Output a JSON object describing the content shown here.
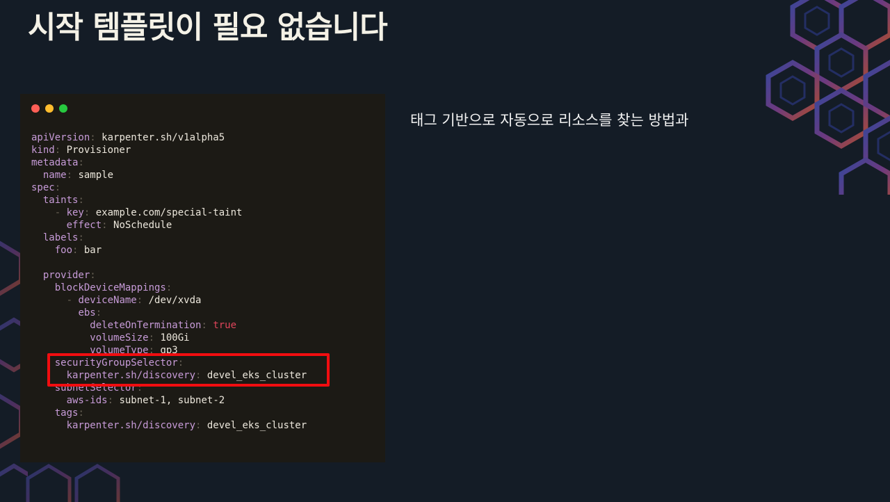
{
  "slide": {
    "title": "시작 템플릿이 필요 없습니다",
    "caption": "태그 기반으로 자동으로 리소스를 찾는 방법과"
  },
  "colors": {
    "background": "#141c26",
    "code_background": "#1c1a15",
    "yaml_key": "#c79bd8",
    "yaml_value": "#ece7dc",
    "yaml_boolean": "#e0455b",
    "highlight_border": "#f10d10",
    "traffic_red": "#ff5f56",
    "traffic_yellow": "#ffbd2e",
    "traffic_green": "#27c93f"
  },
  "code_window": {
    "traffic_lights": [
      "close-dot",
      "minimize-dot",
      "maximize-dot"
    ],
    "lines": [
      {
        "indent": "",
        "dash": "",
        "key": "apiVersion",
        "value": "karpenter.sh/v1alpha5",
        "value_type": "str"
      },
      {
        "indent": "",
        "dash": "",
        "key": "kind",
        "value": "Provisioner",
        "value_type": "str"
      },
      {
        "indent": "",
        "dash": "",
        "key": "metadata",
        "value": "",
        "value_type": "str"
      },
      {
        "indent": "  ",
        "dash": "",
        "key": "name",
        "value": "sample",
        "value_type": "str"
      },
      {
        "indent": "",
        "dash": "",
        "key": "spec",
        "value": "",
        "value_type": "str"
      },
      {
        "indent": "  ",
        "dash": "",
        "key": "taints",
        "value": "",
        "value_type": "str"
      },
      {
        "indent": "    ",
        "dash": "- ",
        "key": "key",
        "value": "example.com/special-taint",
        "value_type": "str"
      },
      {
        "indent": "      ",
        "dash": "",
        "key": "effect",
        "value": "NoSchedule",
        "value_type": "str"
      },
      {
        "indent": "  ",
        "dash": "",
        "key": "labels",
        "value": "",
        "value_type": "str"
      },
      {
        "indent": "    ",
        "dash": "",
        "key": "foo",
        "value": "bar",
        "value_type": "str"
      },
      {
        "indent": "",
        "dash": "",
        "key": "",
        "value": "",
        "value_type": "blank"
      },
      {
        "indent": "  ",
        "dash": "",
        "key": "provider",
        "value": "",
        "value_type": "str"
      },
      {
        "indent": "    ",
        "dash": "",
        "key": "blockDeviceMappings",
        "value": "",
        "value_type": "str"
      },
      {
        "indent": "      ",
        "dash": "- ",
        "key": "deviceName",
        "value": "/dev/xvda",
        "value_type": "str"
      },
      {
        "indent": "        ",
        "dash": "",
        "key": "ebs",
        "value": "",
        "value_type": "str"
      },
      {
        "indent": "          ",
        "dash": "",
        "key": "deleteOnTermination",
        "value": "true",
        "value_type": "bool"
      },
      {
        "indent": "          ",
        "dash": "",
        "key": "volumeSize",
        "value": "100Gi",
        "value_type": "str"
      },
      {
        "indent": "          ",
        "dash": "",
        "key": "volumeType",
        "value": "gp3",
        "value_type": "str"
      },
      {
        "indent": "    ",
        "dash": "",
        "key": "securityGroupSelector",
        "value": "",
        "value_type": "str"
      },
      {
        "indent": "      ",
        "dash": "",
        "key": "karpenter.sh/discovery",
        "value": "devel_eks_cluster",
        "value_type": "str"
      },
      {
        "indent": "    ",
        "dash": "",
        "key": "subnetSelector",
        "value": "",
        "value_type": "str"
      },
      {
        "indent": "      ",
        "dash": "",
        "key": "aws-ids",
        "value": "subnet-1, subnet-2",
        "value_type": "str"
      },
      {
        "indent": "    ",
        "dash": "",
        "key": "tags",
        "value": "",
        "value_type": "str"
      },
      {
        "indent": "      ",
        "dash": "",
        "key": "karpenter.sh/discovery",
        "value": "devel_eks_cluster",
        "value_type": "str"
      }
    ],
    "highlighted_lines": [
      18,
      19
    ]
  },
  "decorations": {
    "icon": "hexagon-cube-pattern"
  }
}
